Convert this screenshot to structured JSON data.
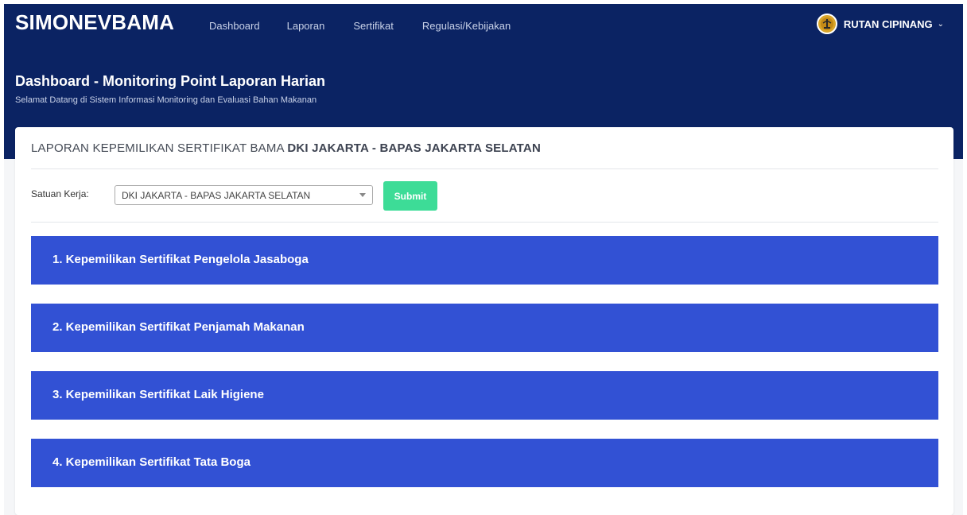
{
  "header": {
    "brand": "SIMONEVBAMA",
    "nav": [
      "Dashboard",
      "Laporan",
      "Sertifikat",
      "Regulasi/Kebijakan"
    ],
    "user": "RUTAN CIPINANG"
  },
  "hero": {
    "title": "Dashboard - Monitoring Point Laporan Harian",
    "subtitle": "Selamat Datang di Sistem Informasi Monitoring dan Evaluasi Bahan Makanan"
  },
  "card": {
    "title_prefix": "LAPORAN KEPEMILIKAN SERTIFIKAT BAMA",
    "title_unit": "DKI JAKARTA - BAPAS JAKARTA SELATAN",
    "filter_label": "Satuan Kerja:",
    "filter_value": "DKI JAKARTA - BAPAS JAKARTA SELATAN",
    "submit_label": "Submit"
  },
  "sections": [
    "1. Kepemilikan Sertifikat Pengelola Jasaboga",
    "2. Kepemilikan Sertifikat Penjamah Makanan",
    "3. Kepemilikan Sertifikat Laik Higiene",
    "4. Kepemilikan Sertifikat Tata Boga"
  ],
  "colors": {
    "header_bg": "#0b2363",
    "section_bg": "#3251d4",
    "submit_bg": "#3ddc97"
  }
}
